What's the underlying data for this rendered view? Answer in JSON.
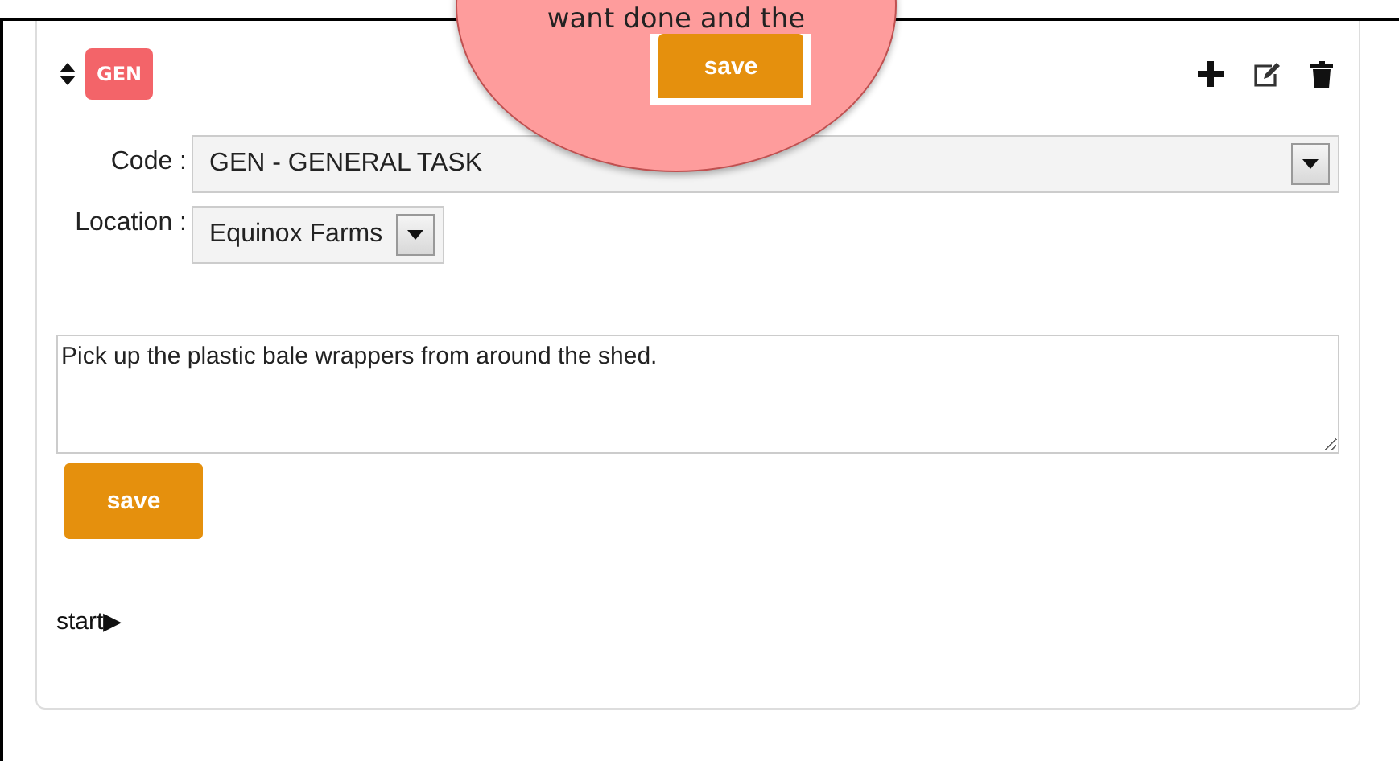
{
  "task_card": {
    "badge": "GEN",
    "code": {
      "label": "Code :",
      "value": "GEN - GENERAL TASK"
    },
    "location": {
      "label": "Location :",
      "value": "Equinox Farms"
    },
    "description": "Pick up the plastic bale wrappers from around the shed.",
    "save_button": "save",
    "start_link": "start▶"
  },
  "callout": {
    "text": "want done and the",
    "button": "save"
  }
}
